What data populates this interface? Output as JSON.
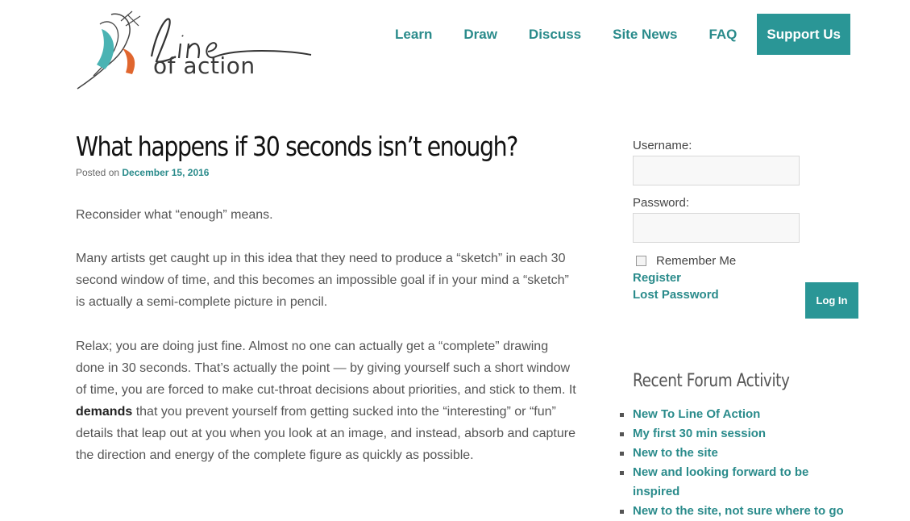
{
  "site": {
    "logo_script": "Line",
    "logo_text": "of action"
  },
  "nav": {
    "items": [
      "Learn",
      "Draw",
      "Discuss",
      "Site News",
      "FAQ"
    ],
    "support": "Support Us"
  },
  "post": {
    "title": "What happens if 30 seconds isn’t enough?",
    "posted_on": "Posted on",
    "date": "December 15, 2016",
    "p1": "Reconsider what “enough” means.",
    "p2": "Many artists get caught up in this idea that they need to produce a “sketch” in each 30 second window of time, and this becomes an impossible goal if in your mind a “sketch” is actually a semi-complete picture in pencil.",
    "p3_before": "Relax; you are doing just fine. Almost no one can actually get a “complete” drawing done in 30 seconds. That’s actually the point — by giving yourself such a short window of time, you are forced to make cut-throat decisions about priorities, and stick to them. It ",
    "p3_bold": "demands",
    "p3_after": " that you prevent yourself from getting sucked into the “interesting” or “fun” details that leap out at you when you look at an image, and instead, absorb and capture the direction and energy of the complete figure as quickly as possible."
  },
  "login": {
    "username_label": "Username:",
    "password_label": "Password:",
    "remember": "Remember Me",
    "register": "Register",
    "lost_password": "Lost Password",
    "button": "Log In"
  },
  "forum": {
    "heading": "Recent Forum Activity",
    "items": [
      "New To Line Of Action",
      "My first 30 min session",
      "New to the site",
      "New and looking forward to be inspired",
      "New to the site, not sure where to go"
    ]
  },
  "colors": {
    "accent": "#2a9696",
    "link": "#2a8b8b"
  }
}
